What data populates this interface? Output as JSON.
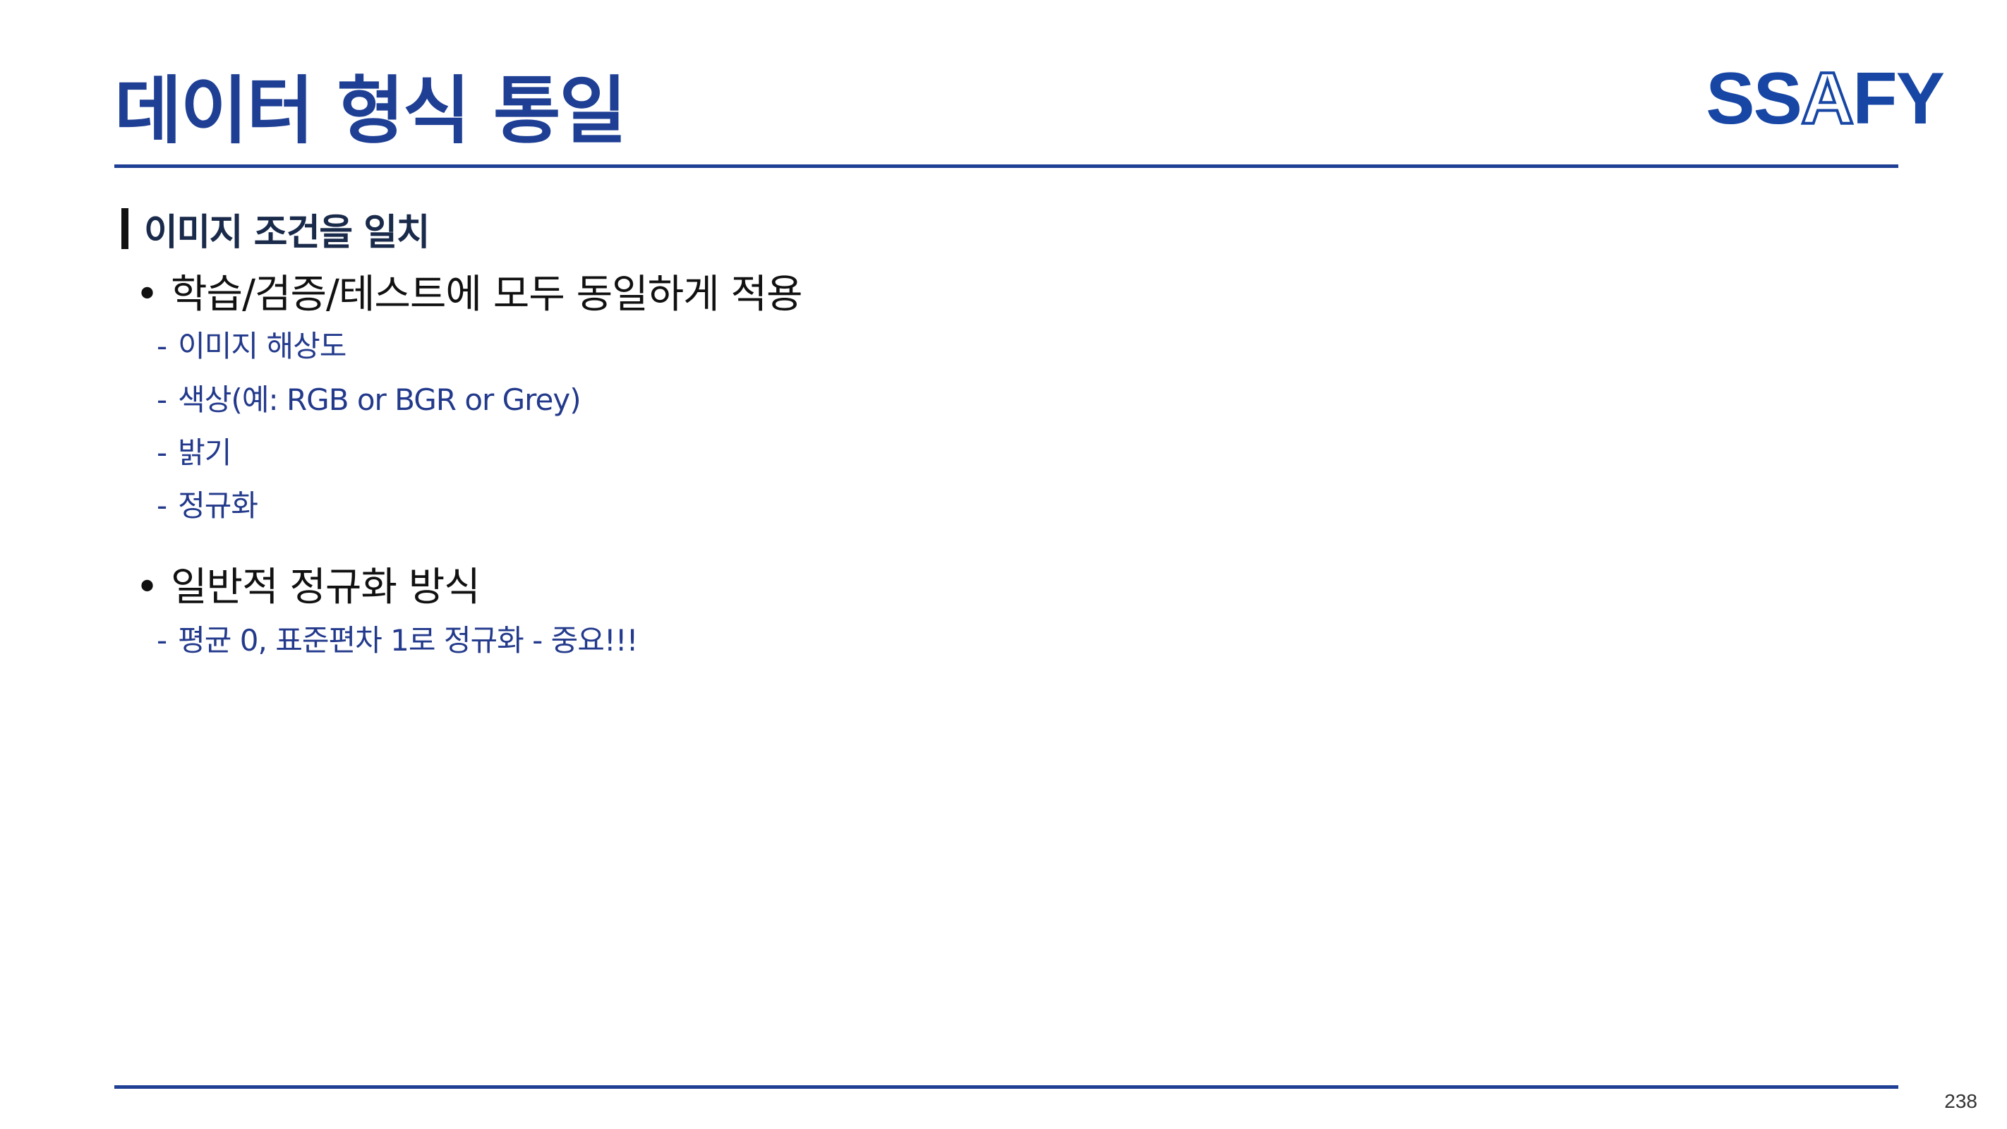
{
  "slide": {
    "title": "데이터 형식 통일",
    "page_number": "238"
  },
  "logo": {
    "part1": "SS",
    "part2": "A",
    "part3": "FY"
  },
  "content": {
    "section_heading": "이미지 조건을 일치",
    "bullets": [
      {
        "text": "학습/검증/테스트에 모두 동일하게 적용",
        "items": [
          "이미지 해상도",
          "색상(예: RGB or BGR or Grey)",
          "밝기",
          "정규화"
        ]
      },
      {
        "text": "일반적 정규화 방식",
        "items": [
          "평균 0, 표준편차 1로 정규화 - 중요!!!"
        ]
      }
    ],
    "bullet_marker": "•",
    "item_marker": "-"
  },
  "colors": {
    "primary": "#1e3f94",
    "logo": "#1746a5",
    "subitem": "#233a8c"
  }
}
